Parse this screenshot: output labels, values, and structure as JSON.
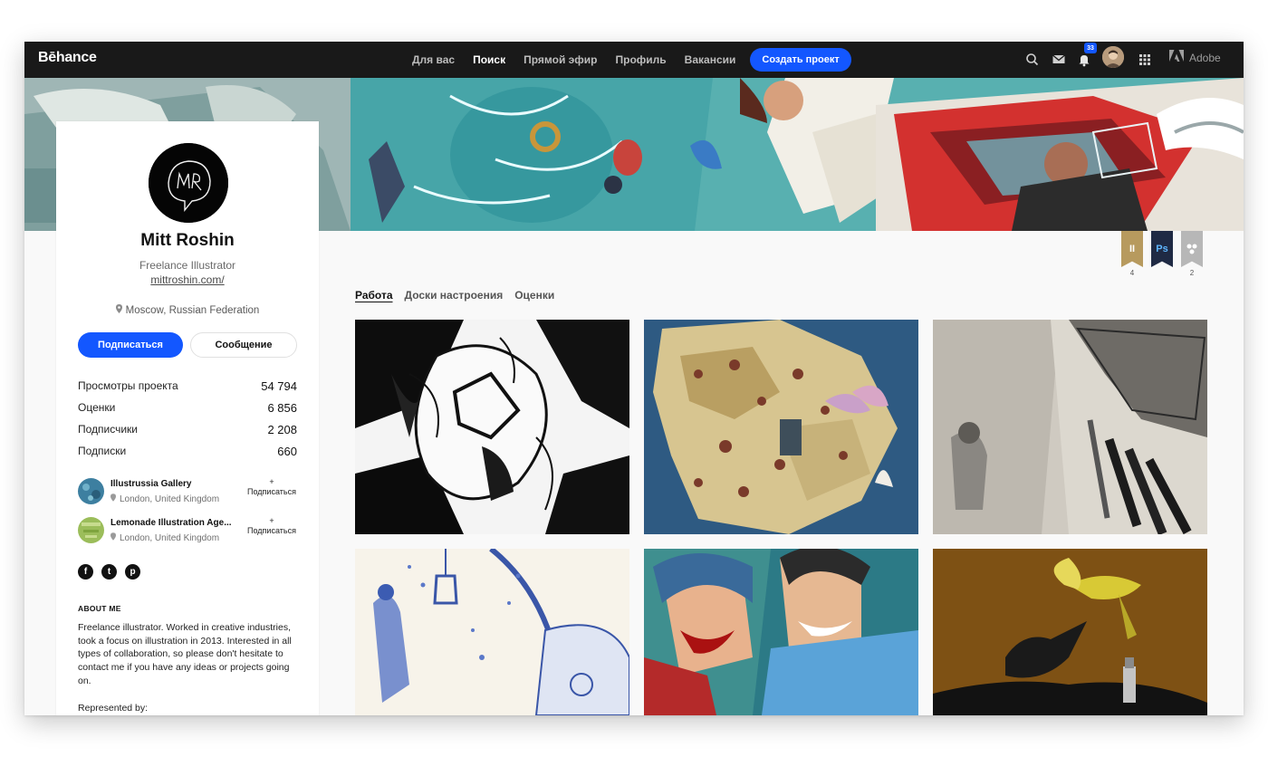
{
  "nav": {
    "logo": "Bēhance",
    "links": [
      "Для вас",
      "Поиск",
      "Прямой эфир",
      "Профиль",
      "Вакансии"
    ],
    "create_button": "Создать проект",
    "notification_count": "33",
    "adobe_label": "Adobe",
    "icons": [
      "search-icon",
      "mail-icon",
      "bell-icon",
      "apps-grid-icon",
      "adobe-logo-icon"
    ]
  },
  "profile": {
    "name": "Mitt Roshin",
    "occupation": "Freelance Illustrator",
    "website": "mittroshin.com/",
    "location": "Moscow, Russian Federation",
    "follow_button": "Подписаться",
    "message_button": "Сообщение",
    "stats": [
      {
        "label": "Просмотры проекта",
        "value": "54 794"
      },
      {
        "label": "Оценки",
        "value": "6 856"
      },
      {
        "label": "Подписчики",
        "value": "2 208"
      },
      {
        "label": "Подписки",
        "value": "660"
      }
    ],
    "teams": [
      {
        "name": "Illustrussia Gallery",
        "location": "London, United Kingdom",
        "follow": "+\nПодписаться"
      },
      {
        "name": "Lemonade Illustration Age...",
        "location": "London, United Kingdom",
        "follow": "+\nПодписаться"
      }
    ],
    "socials": [
      "f",
      "t",
      "p"
    ],
    "about_title": "ABOUT ME",
    "about_text": "Freelance illustrator. Worked in creative industries, took a focus on illustration in 2013. Interested in all types of collaboration, so please don't hesitate to contact me if you have any ideas or projects going on.",
    "represented_by": "Represented by:"
  },
  "badges": [
    {
      "icon": "illustrator-badge-icon",
      "label": "II",
      "count": "4",
      "color": "#b79a5e"
    },
    {
      "icon": "photoshop-badge-icon",
      "label": "Ps",
      "count": "",
      "color": "#1f2a44"
    },
    {
      "icon": "behance-reviewed-badge-icon",
      "label": "",
      "count": "2",
      "color": "#b7b7b7"
    }
  ],
  "tabs": [
    "Работа",
    "Доски настроения",
    "Оценки"
  ],
  "colors": {
    "accent": "#1357ff",
    "nav_bg": "#191919",
    "page_bg": "#f9f9f9"
  }
}
